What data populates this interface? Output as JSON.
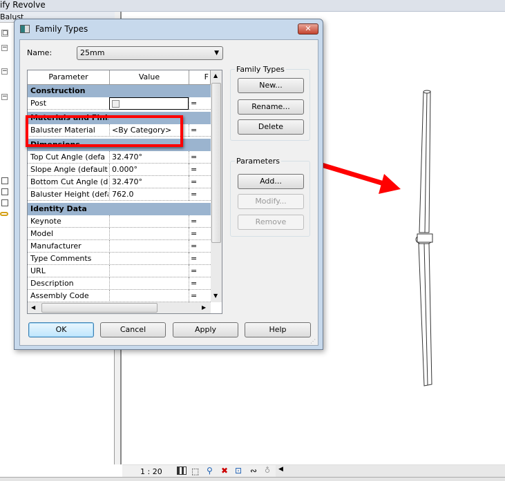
{
  "window": {
    "title": "ify Revolve"
  },
  "left_panel": {
    "header": "Balust"
  },
  "dialog": {
    "title": "Family Types",
    "close": "✕",
    "name_label": "Name:",
    "name_value": "25mm",
    "grid": {
      "headers": [
        "Parameter",
        "Value",
        "F"
      ],
      "rows": [
        {
          "type": "group",
          "label": "Construction"
        },
        {
          "type": "param",
          "name": "Post",
          "value": "",
          "formula": "=",
          "checkbox": true
        },
        {
          "type": "group",
          "label": "Materials and Finishes"
        },
        {
          "type": "param",
          "name": "Baluster Material",
          "value": "<By Category>",
          "formula": "="
        },
        {
          "type": "group",
          "label": "Dimensions"
        },
        {
          "type": "param",
          "name": "Top Cut Angle (defa",
          "value": "32.470°",
          "formula": "="
        },
        {
          "type": "param",
          "name": "Slope Angle (default)",
          "value": "0.000°",
          "formula": "="
        },
        {
          "type": "param",
          "name": "Bottom Cut Angle (d",
          "value": "32.470°",
          "formula": "="
        },
        {
          "type": "param",
          "name": "Baluster Height (defa",
          "value": "762.0",
          "formula": "="
        },
        {
          "type": "group",
          "label": "Identity Data"
        },
        {
          "type": "param",
          "name": "Keynote",
          "value": "",
          "formula": "="
        },
        {
          "type": "param",
          "name": "Model",
          "value": "",
          "formula": "="
        },
        {
          "type": "param",
          "name": "Manufacturer",
          "value": "",
          "formula": "="
        },
        {
          "type": "param",
          "name": "Type Comments",
          "value": "",
          "formula": "="
        },
        {
          "type": "param",
          "name": "URL",
          "value": "",
          "formula": "="
        },
        {
          "type": "param",
          "name": "Description",
          "value": "",
          "formula": "="
        },
        {
          "type": "param",
          "name": "Assembly Code",
          "value": "",
          "formula": "="
        }
      ]
    },
    "family_types_group": {
      "label": "Family Types",
      "new": "New...",
      "rename": "Rename...",
      "delete": "Delete"
    },
    "parameters_group": {
      "label": "Parameters",
      "add": "Add...",
      "modify": "Modify...",
      "remove": "Remove"
    },
    "buttons": {
      "ok": "OK",
      "cancel": "Cancel",
      "apply": "Apply",
      "help": "Help"
    }
  },
  "status": {
    "scale": "1 : 20"
  },
  "annotation_color": "#ff0000"
}
